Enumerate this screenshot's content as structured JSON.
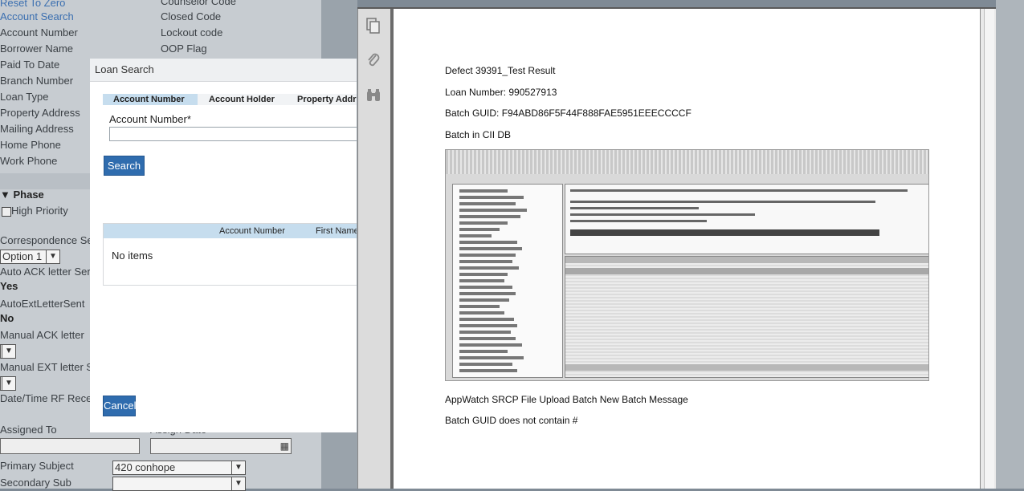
{
  "background_form": {
    "fields_left": [
      "Reset To Zero",
      "Account Search",
      "Account Number",
      "Borrower Name",
      "Paid To Date",
      "Branch Number",
      "Loan Type",
      "Property Address",
      "Mailing Address",
      "Home Phone",
      "Work Phone"
    ],
    "fields_right": [
      "Counselor Code",
      "Closed Code",
      "Lockout code",
      "OOP Flag"
    ],
    "phase_label": "Phase",
    "high_priority_label": "High Priority",
    "correspondence_label": "Correspondence Se",
    "option_value": "Option 1",
    "auto_ack_label": "Auto ACK letter Ser",
    "auto_ack_value": "Yes",
    "auto_ext_label": "AutoExtLetterSent",
    "auto_ext_value": "No",
    "manual_ack_label": "Manual ACK letter",
    "manual_ext_label": "Manual EXT letter S",
    "date_rf_label": "Date/Time RF Rece",
    "assigned_to_label": "Assigned To",
    "assign_date_label": "Assign Date",
    "primary_subject_label": "Primary Subject",
    "primary_subject_value": "420 conhope",
    "secondary_sub_label": "Secondary Sub"
  },
  "modal": {
    "title": "Loan Search",
    "tabs": [
      "Account Number",
      "Account Holder",
      "Property Addr"
    ],
    "field_label": "Account Number*",
    "search_button": "Search",
    "grid_headers": [
      "Account Number",
      "First Name"
    ],
    "empty_text": "No items",
    "cancel_button": "Cancel"
  },
  "viewer": {
    "icons": [
      "pages-icon",
      "paperclip-icon",
      "binoculars-icon"
    ]
  },
  "document": {
    "lines": [
      "Defect 39391_Test Result",
      "Loan Number: 990527913",
      "Batch GUID: F94ABD86F5F44F888FAE5951EEECCCCF",
      "Batch in CII DB",
      "AppWatch SRCP File Upload Batch New Batch Message",
      "Batch GUID does not contain #"
    ]
  }
}
